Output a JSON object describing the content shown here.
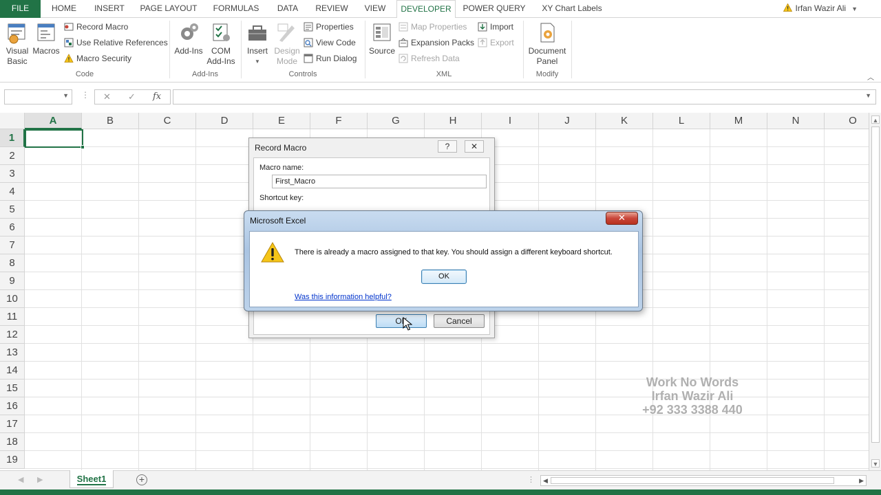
{
  "ribbon_tabs": [
    {
      "label": "FILE"
    },
    {
      "label": "HOME"
    },
    {
      "label": "INSERT"
    },
    {
      "label": "PAGE LAYOUT"
    },
    {
      "label": "FORMULAS"
    },
    {
      "label": "DATA"
    },
    {
      "label": "REVIEW"
    },
    {
      "label": "VIEW"
    },
    {
      "label": "DEVELOPER"
    },
    {
      "label": "POWER QUERY"
    },
    {
      "label": "XY Chart Labels"
    }
  ],
  "active_tab": "DEVELOPER",
  "user": {
    "name": "Irfan Wazir Ali"
  },
  "ribbon": {
    "code": {
      "label": "Code",
      "visual_basic": "Visual\nBasic",
      "macros": "Macros",
      "record_macro": "Record Macro",
      "use_relative_references": "Use Relative References",
      "macro_security": "Macro Security"
    },
    "addins": {
      "label": "Add-Ins",
      "add_ins": "Add-Ins",
      "com_add_ins": "COM\nAdd-Ins"
    },
    "controls": {
      "label": "Controls",
      "insert": "Insert",
      "design_mode": "Design\nMode",
      "properties": "Properties",
      "view_code": "View Code",
      "run_dialog": "Run Dialog"
    },
    "xml": {
      "label": "XML",
      "source": "Source",
      "map_properties": "Map Properties",
      "expansion_packs": "Expansion Packs",
      "refresh_data": "Refresh Data",
      "import": "Import",
      "export": "Export"
    },
    "modify": {
      "label": "Modify",
      "document_panel": "Document\nPanel"
    }
  },
  "formula_bar": {
    "name_box": "",
    "fx": "fx",
    "content": ""
  },
  "columns": [
    "A",
    "B",
    "C",
    "D",
    "E",
    "F",
    "G",
    "H",
    "I",
    "J",
    "K",
    "L",
    "M",
    "N",
    "O"
  ],
  "rows": [
    "1",
    "2",
    "3",
    "4",
    "5",
    "6",
    "7",
    "8",
    "9",
    "10",
    "11",
    "12",
    "13",
    "14",
    "15",
    "16",
    "17",
    "18",
    "19"
  ],
  "active_cell": "A1",
  "sheets": [
    {
      "name": "Sheet1",
      "active": true
    }
  ],
  "watermark": {
    "line1": "Work No Words",
    "line2": "Irfan Wazir Ali",
    "line3": "+92 333 3388 440"
  },
  "record_macro_dialog": {
    "title": "Record Macro",
    "help": "?",
    "close": "✕",
    "macro_name_label": "Macro name:",
    "macro_name_value": "First_Macro",
    "shortcut_key_label": "Shortcut key:",
    "ok": "OK",
    "cancel": "Cancel"
  },
  "alert_dialog": {
    "title": "Microsoft Excel",
    "close": "✕",
    "message": "There is already a macro assigned to that key. You should assign a different keyboard shortcut.",
    "ok": "OK",
    "help_link": "Was this information helpful?"
  },
  "colors": {
    "excel_green": "#217346",
    "warning_yellow": "#f5c518",
    "link_blue": "#0033cc"
  }
}
